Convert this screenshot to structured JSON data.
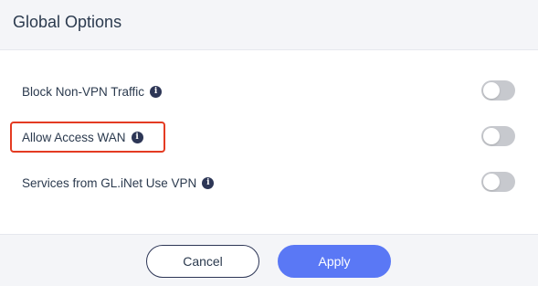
{
  "dialog": {
    "title": "Global Options"
  },
  "options": [
    {
      "label": "Block Non-VPN Traffic",
      "info_icon": "info-icon",
      "enabled": false
    },
    {
      "label": "Allow Access WAN",
      "info_icon": "info-icon",
      "enabled": false,
      "highlighted": true
    },
    {
      "label": "Services from GL.iNet Use VPN",
      "info_icon": "info-icon",
      "enabled": false
    }
  ],
  "footer": {
    "cancel_label": "Cancel",
    "apply_label": "Apply"
  },
  "colors": {
    "accent": "#5a78f5",
    "highlight": "#e43b22",
    "toggle_off": "#c7c9ce",
    "header_bg": "#f4f5f8"
  },
  "info_glyph": "i"
}
